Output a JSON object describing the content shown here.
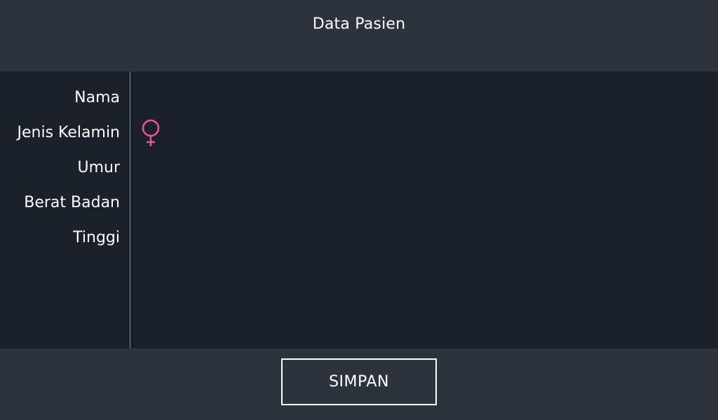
{
  "header": {
    "title": "Data Pasien"
  },
  "form": {
    "fields": [
      {
        "label": "Nama",
        "value": ""
      },
      {
        "label": "Jenis Kelamin",
        "value_icon": "female-icon"
      },
      {
        "label": "Umur",
        "value": ""
      },
      {
        "label": "Berat Badan",
        "value": ""
      },
      {
        "label": "Tinggi",
        "value": ""
      }
    ]
  },
  "colors": {
    "header_bg": "#2d333d",
    "content_bg": "#1b2029",
    "female_icon": "#e8589c",
    "divider": "#8b9098"
  },
  "footer": {
    "save_label": "SIMPAN"
  }
}
